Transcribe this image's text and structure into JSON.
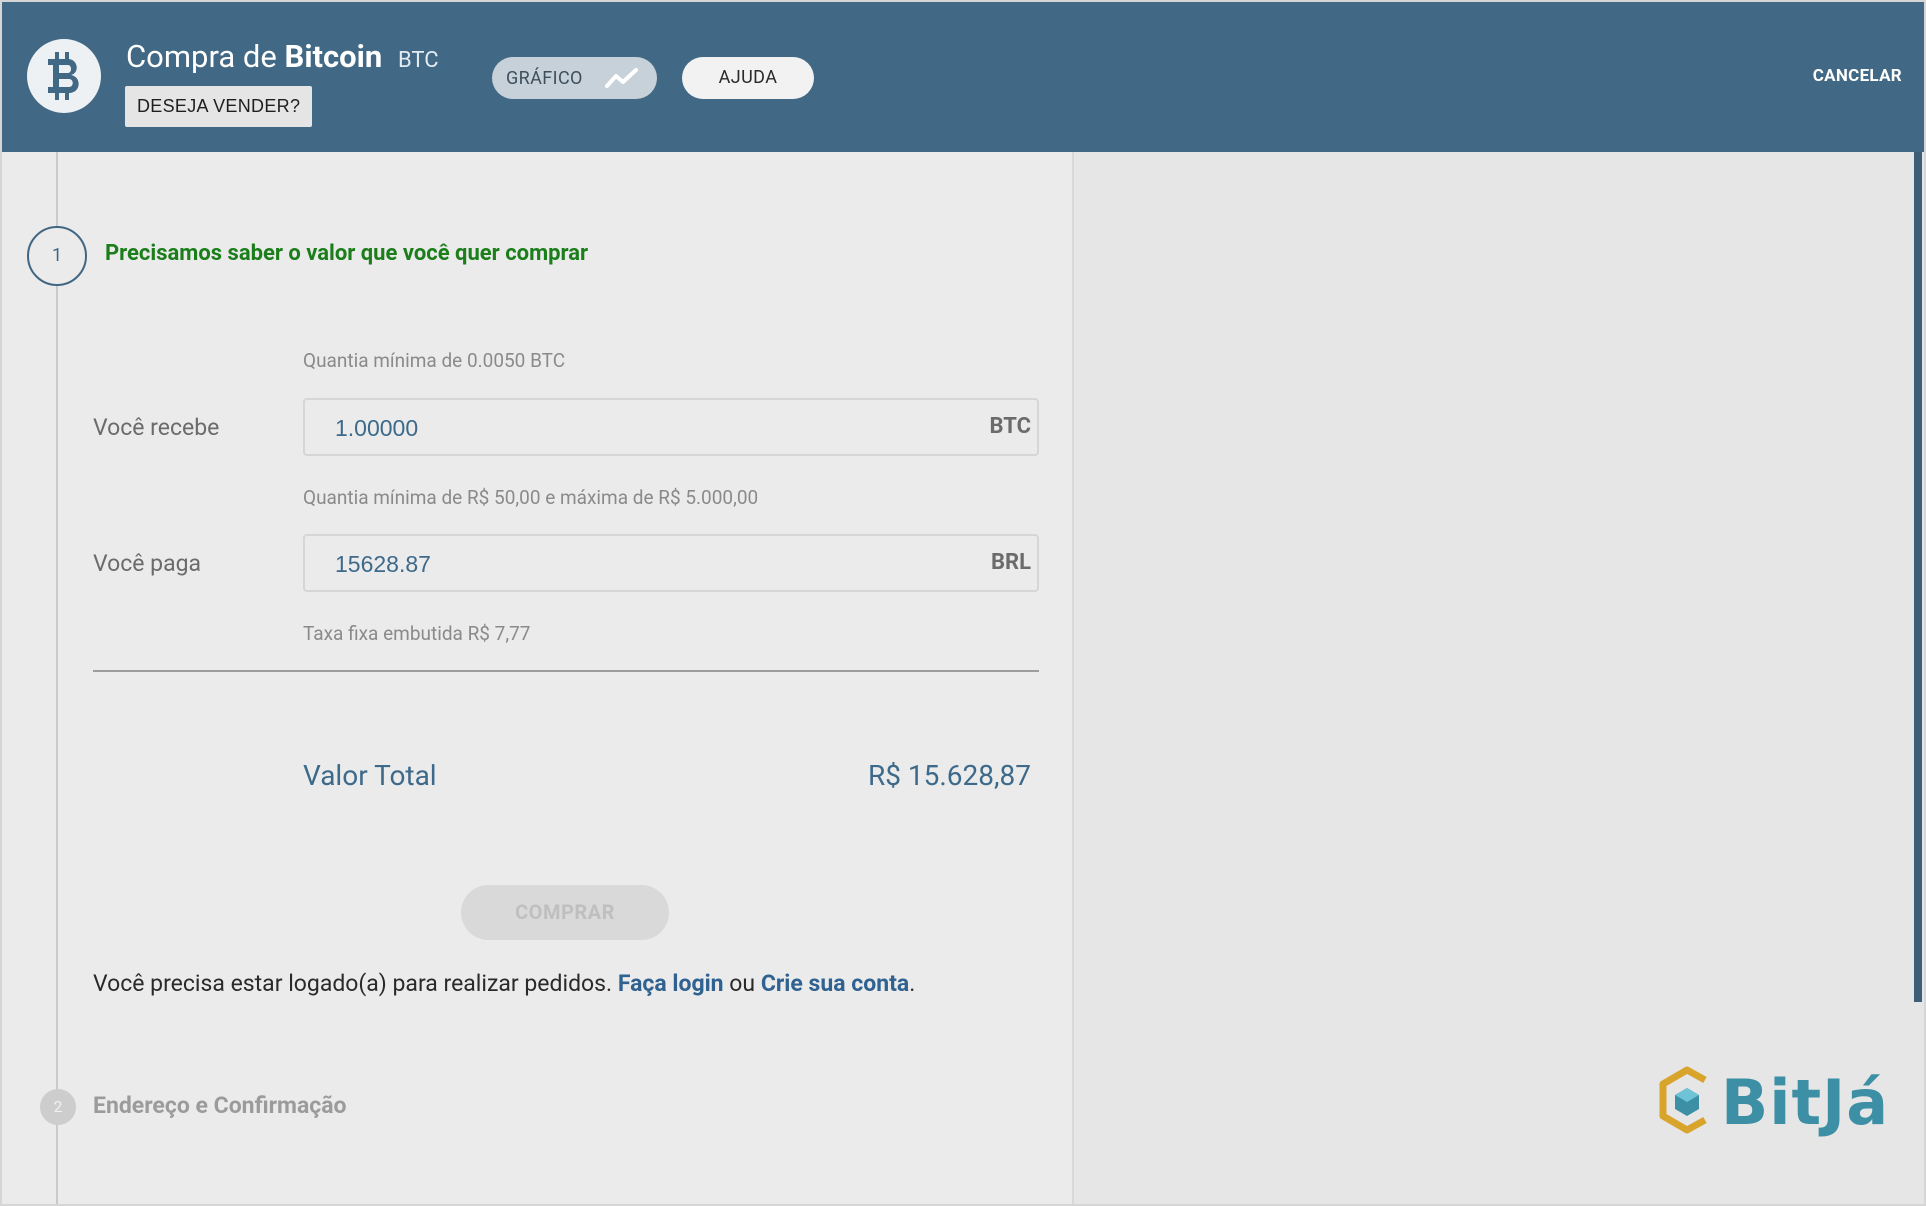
{
  "header": {
    "title_prefix": "Compra de",
    "title_bold": "Bitcoin",
    "ticker": "BTC",
    "sell_label": "DESEJA VENDER?",
    "chart_label": "GRÁFICO",
    "help_label": "AJUDA",
    "cancel_label": "CANCELAR",
    "logo_icon": "bitcoin-icon",
    "chart_icon": "trend-line-icon"
  },
  "step1": {
    "number": "1",
    "title": "Precisamos saber o valor que você quer comprar"
  },
  "receive": {
    "hint": "Quantia mínima de 0.0050 BTC",
    "label": "Você recebe",
    "value": "1.00000",
    "suffix": "BTC"
  },
  "pay": {
    "hint": "Quantia mínima de R$ 50,00 e máxima de R$ 5.000,00",
    "label": "Você paga",
    "value": "15628.87",
    "suffix": "BRL",
    "fee_note": "Taxa fixa embutida R$ 7,77"
  },
  "total": {
    "label": "Valor Total",
    "value": "R$ 15.628,87"
  },
  "buy_label": "COMPRAR",
  "login": {
    "message": "Você precisa estar logado(a) para realizar pedidos.",
    "login_link": "Faça login",
    "or": "ou",
    "signup_link": "Crie sua conta",
    "end": "."
  },
  "step2": {
    "number": "2",
    "title": "Endereço e Confirmação"
  },
  "brand": {
    "name": "BitJá"
  },
  "colors": {
    "header": "#416884",
    "accent": "#3d6a8b",
    "step_title": "#1b7e1b"
  }
}
